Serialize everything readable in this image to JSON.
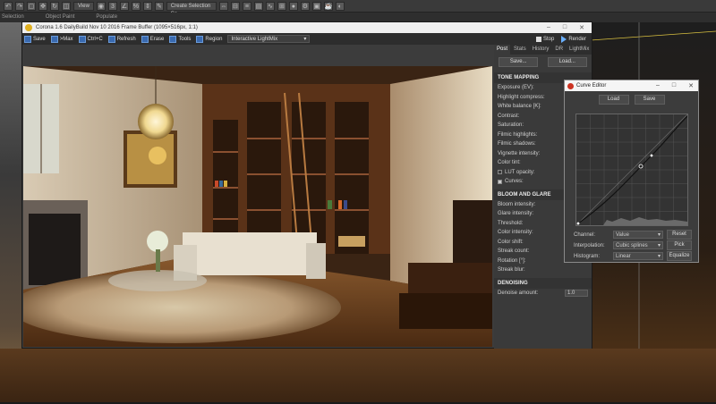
{
  "max_toolbar": {
    "dropdown_view": "View",
    "dropdown_selection": "Create Selection Se"
  },
  "max_tabs": [
    "Selection",
    "Object Paint",
    "Populate"
  ],
  "frame_buffer": {
    "title": "Corona 1.6 DailyBuild Nov 10 2016 Frame Buffer (1095×516px, 1:1)",
    "toolbar": {
      "save": "Save",
      "max": ">Max",
      "ctrl_c": "Ctrl+C",
      "refresh": "Refresh",
      "erase": "Erase",
      "tools": "Tools",
      "region": "Region",
      "lightmix": "Interactive LightMix",
      "stop": "Stop",
      "render": "Render"
    },
    "window_controls": [
      "–",
      "□",
      "✕"
    ]
  },
  "post_panel": {
    "tabs": [
      "Post",
      "Stats",
      "History",
      "DR",
      "LightMix"
    ],
    "save": "Save...",
    "load": "Load...",
    "tone_mapping": {
      "header": "TONE MAPPING",
      "rows": [
        "Exposure (EV):",
        "Highlight compress:",
        "White balance [K]:",
        "Contrast:",
        "Saturation:",
        "Filmic highlights:",
        "Filmic shadows:",
        "Vignette intensity:",
        "Color tint:"
      ],
      "lut": "LUT opacity:",
      "curves": "Curves:"
    },
    "bloom": {
      "header": "BLOOM AND GLARE",
      "rows": [
        "Bloom intensity:",
        "Glare intensity:",
        "Threshold:",
        "Color intensity:",
        "Color shift:",
        "Streak count:",
        "Rotation [°]:",
        "Streak blur:"
      ]
    },
    "denoising": {
      "header": "DENOISING",
      "label": "Denoise amount:",
      "value": "1.0"
    }
  },
  "curve_editor": {
    "title": "Curve Editor",
    "load": "Load",
    "save": "Save",
    "channel_label": "Channel:",
    "channel_value": "Value",
    "interpolation_label": "Interpolation:",
    "interpolation_value": "Cubic splines",
    "histogram_label": "Histogram:",
    "histogram_value": "Linear",
    "reset": "Reset",
    "pick": "Pick",
    "equalize": "Equalize"
  }
}
